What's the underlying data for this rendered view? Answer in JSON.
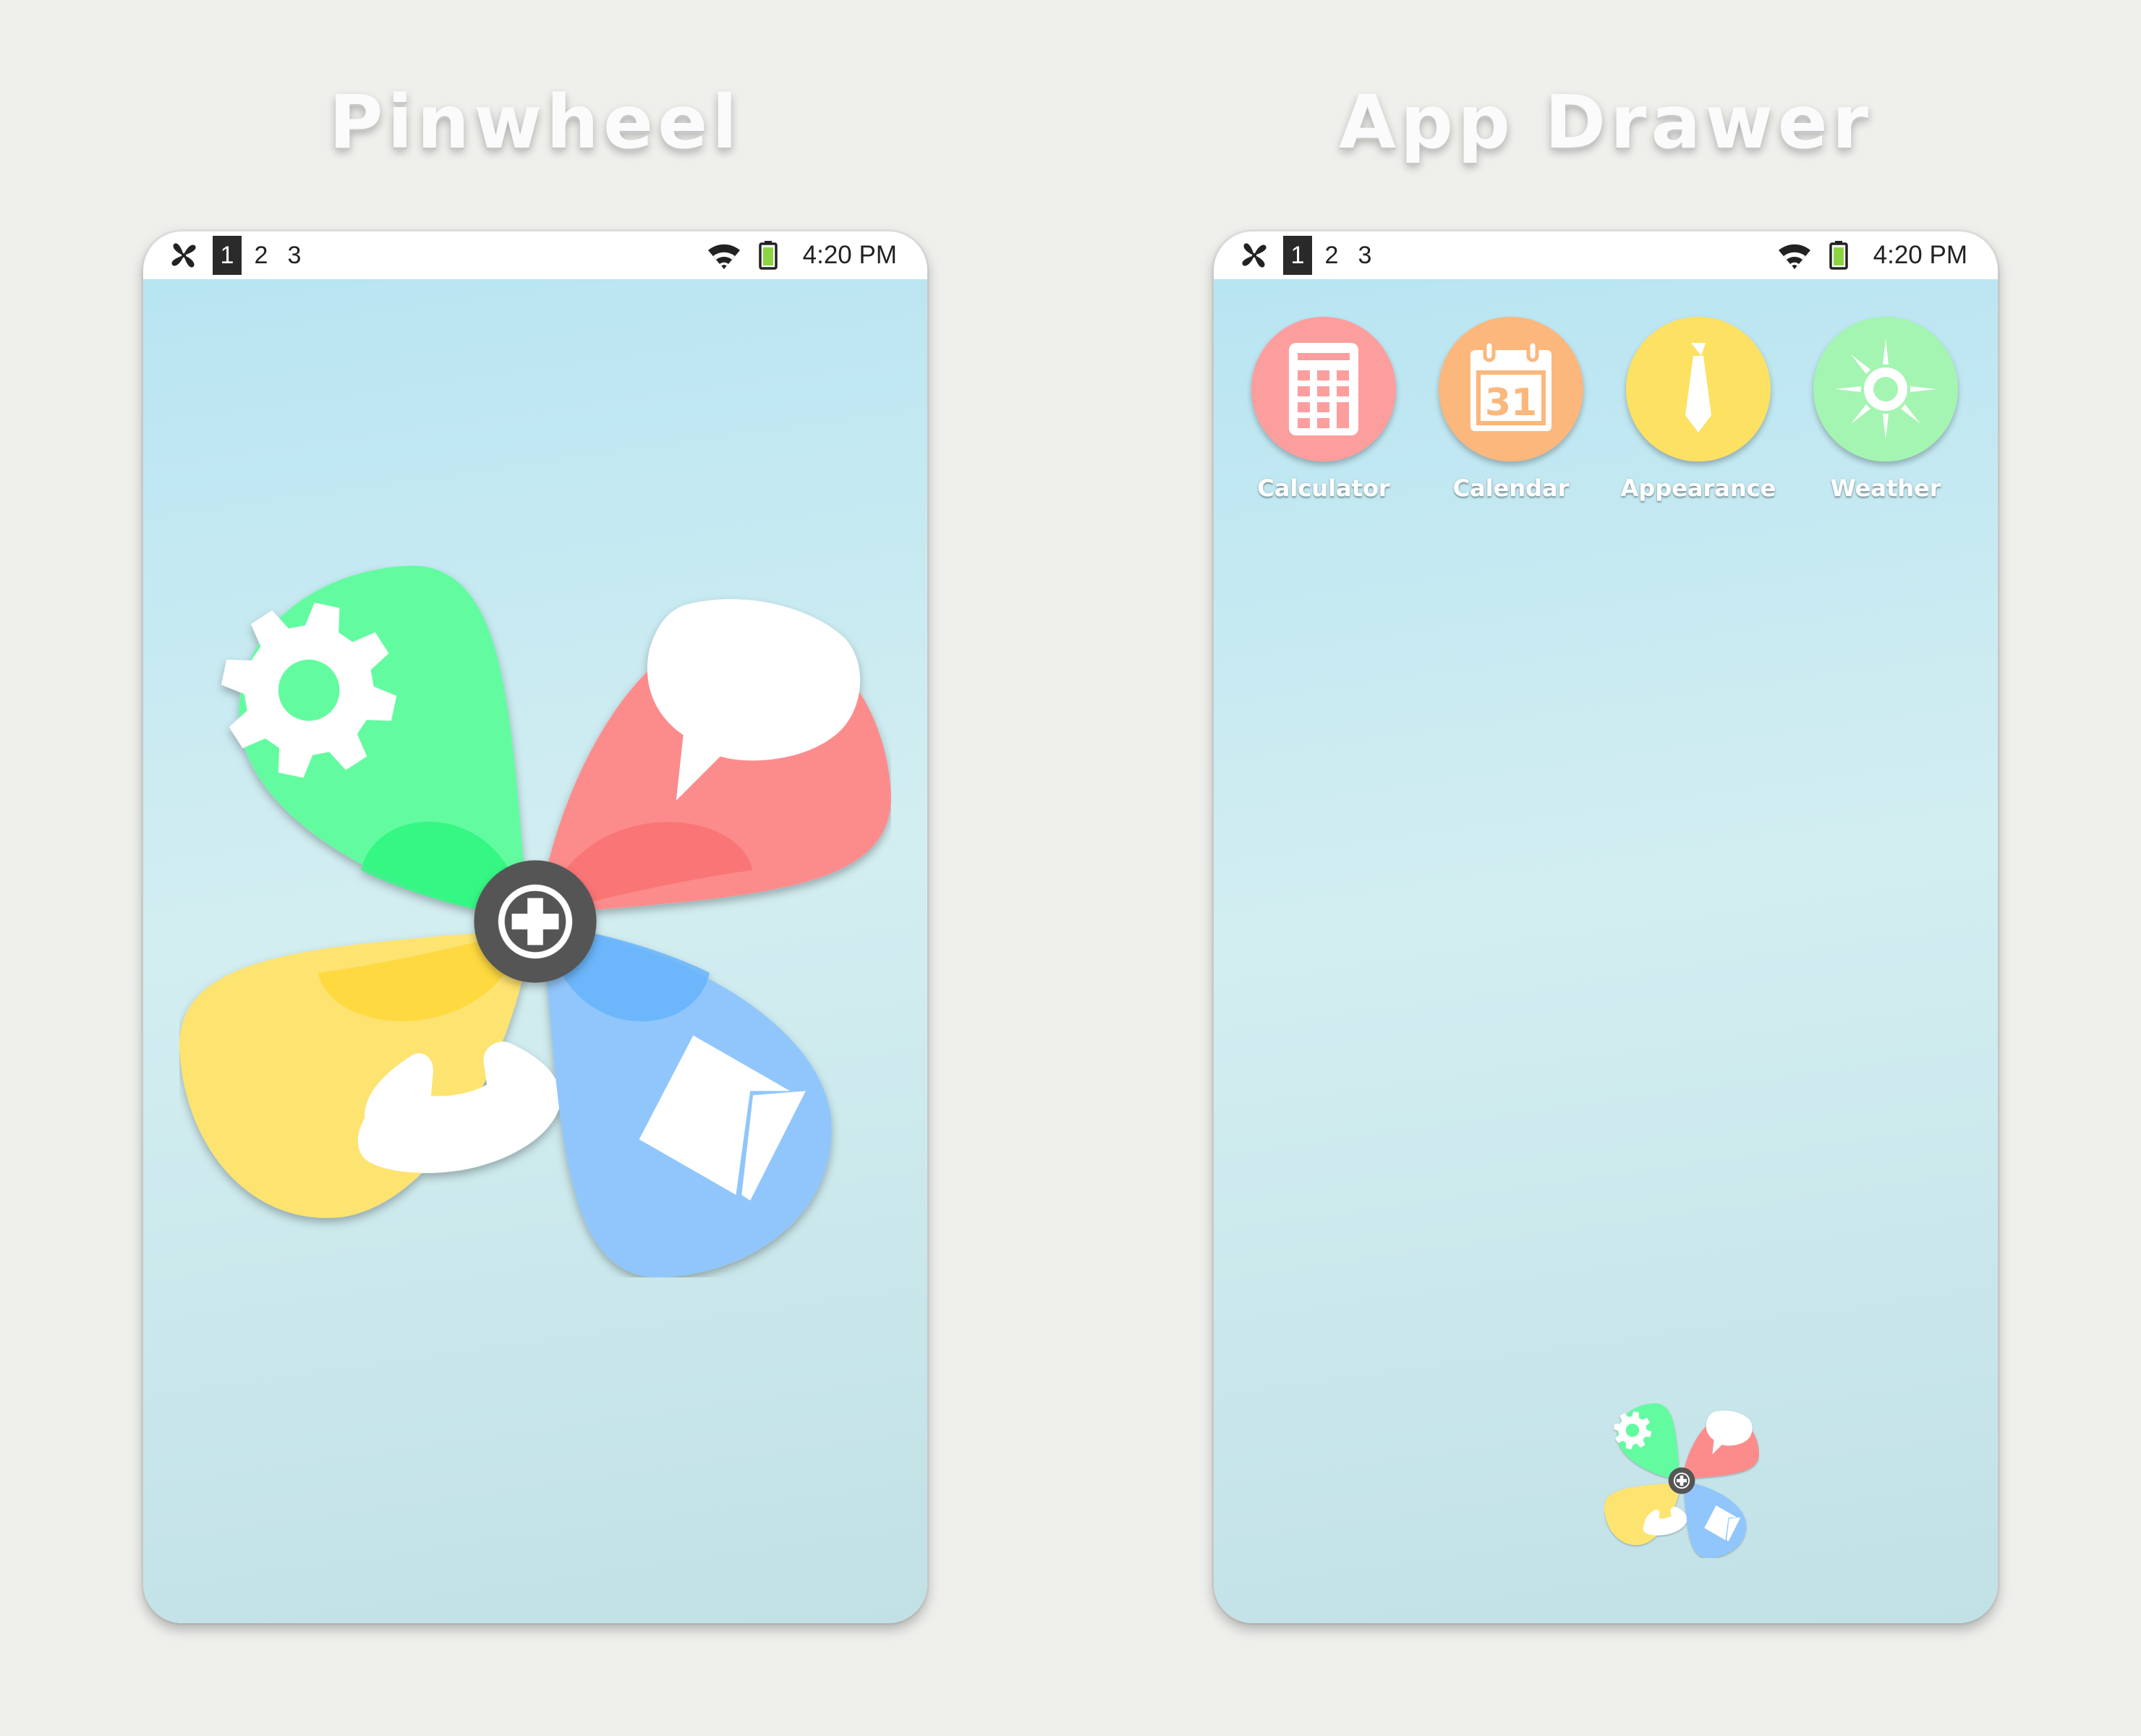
{
  "titles": {
    "left": "Pinwheel",
    "right": "App Drawer"
  },
  "status_bar": {
    "workspaces": [
      "1",
      "2",
      "3"
    ],
    "active_workspace": "1",
    "time": "4:20 PM",
    "icons": [
      "pinwheel-logo-icon",
      "wifi-icon",
      "battery-icon"
    ]
  },
  "pinwheel": {
    "petals": [
      {
        "name": "settings",
        "icon": "gear-icon",
        "color": "#63fba0"
      },
      {
        "name": "messages",
        "icon": "speech-bubble-icon",
        "color": "#fc8c8c"
      },
      {
        "name": "phone",
        "icon": "phone-icon",
        "color": "#fde36f"
      },
      {
        "name": "mail",
        "icon": "envelope-icon",
        "color": "#90c6fb"
      }
    ],
    "center": {
      "icon": "plus-icon",
      "color": "#555555"
    }
  },
  "apps": [
    {
      "label": "Calculator",
      "icon": "calculator-icon",
      "color": "#fd9e9e"
    },
    {
      "label": "Calendar",
      "icon": "calendar-icon",
      "color": "#fcb77c"
    },
    {
      "label": "Appearance",
      "icon": "tie-icon",
      "color": "#fde163"
    },
    {
      "label": "Weather",
      "icon": "sun-icon",
      "color": "#a4f5b1"
    }
  ]
}
